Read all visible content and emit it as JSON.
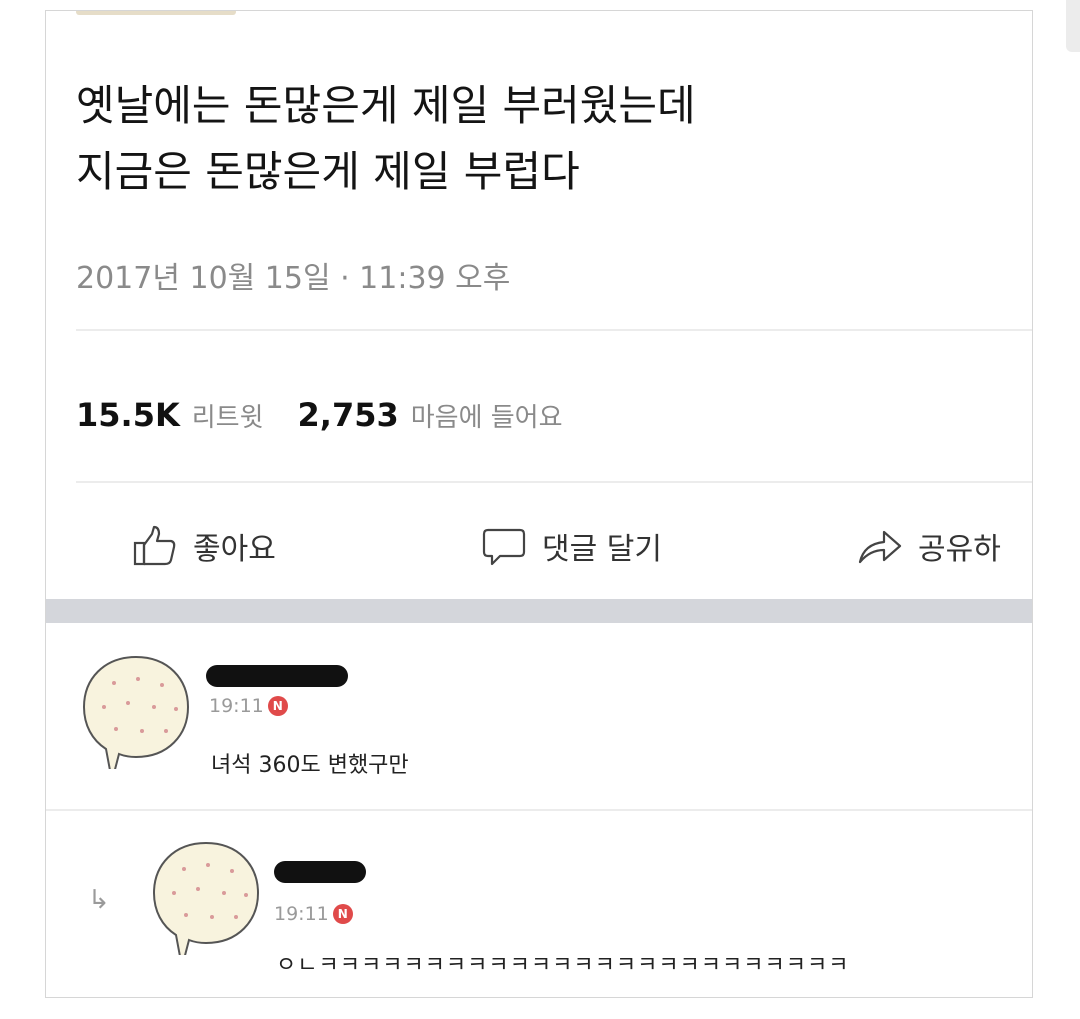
{
  "post": {
    "title_lines": [
      "옛날에는 돈많은게 제일 부러웠는데",
      "지금은 돈많은게 제일 부럽다"
    ],
    "timestamp": "2017년 10월 15일 · 11:39 오후",
    "retweet_count": "15.5K",
    "retweet_label": "리트윗",
    "like_count": "2,753",
    "like_label": "마음에 들어요"
  },
  "actions": [
    {
      "label": "좋아요",
      "icon": "thumbs-up-icon"
    },
    {
      "label": "댓글 달기",
      "icon": "comment-icon"
    },
    {
      "label": "공유하",
      "icon": "share-icon"
    }
  ],
  "comments": [
    {
      "time": "19:11",
      "badge": "N",
      "text": "녀석 360도 변했구만",
      "reply": false
    },
    {
      "time": "19:11",
      "badge": "N",
      "text": "ㅇㄴㅋㅋㅋㅋㅋㅋㅋㅋㅋㅋㅋㅋㅋㅋㅋㅋㅋㅋㅋㅋㅋㅋㅋㅋㅋ",
      "reply": true,
      "reply_marker": "↳"
    }
  ],
  "colors": {
    "band": "#d4d6db",
    "badge": "#e04a4a",
    "muted_text": "#8a8a8a"
  }
}
